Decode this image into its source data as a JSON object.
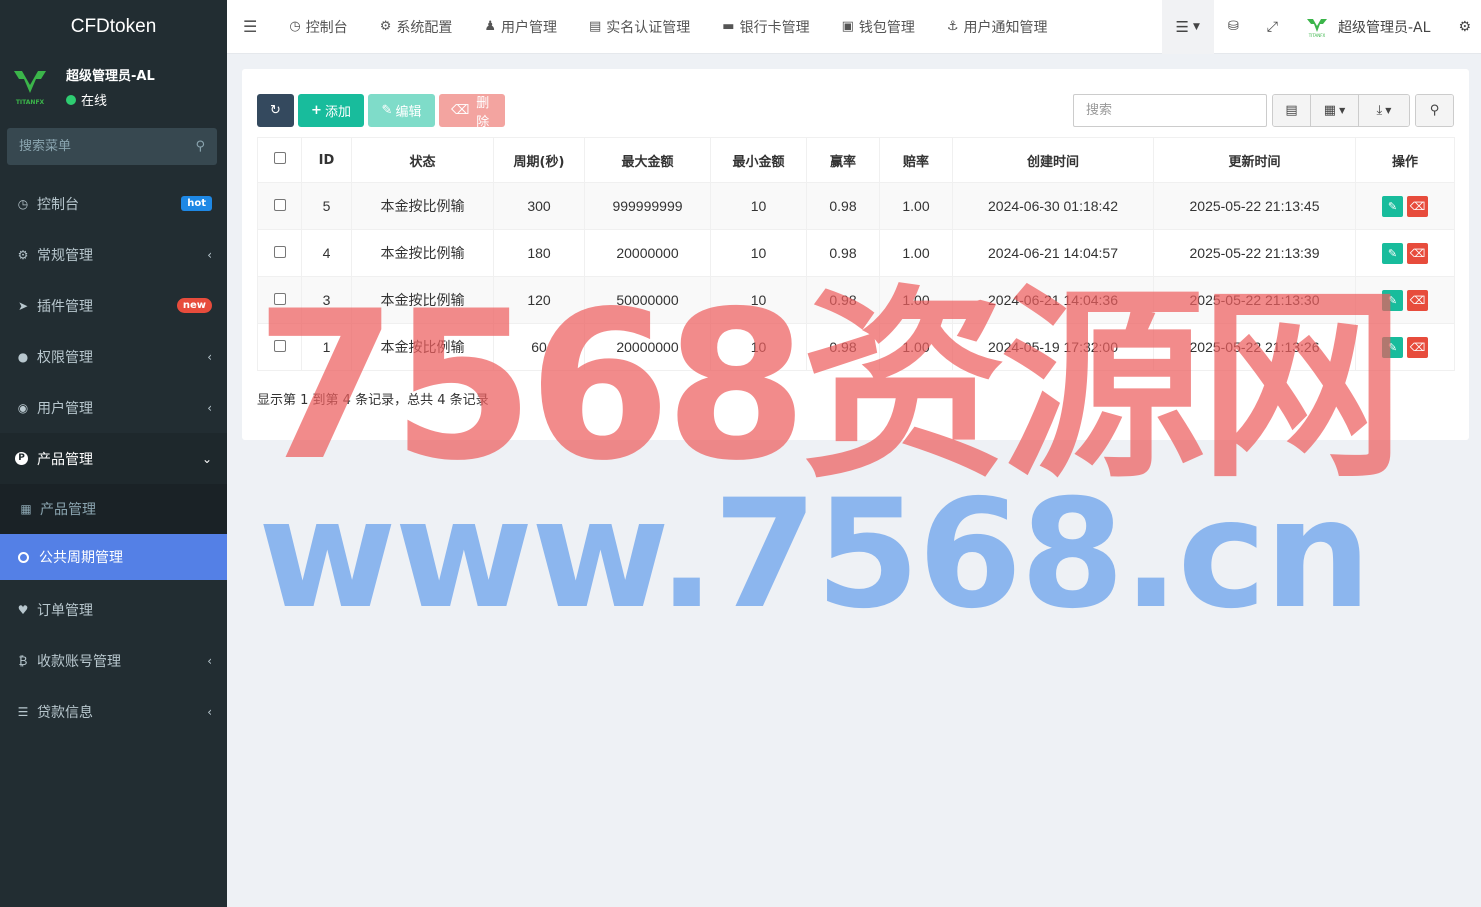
{
  "app": {
    "brand": "CFDtoken"
  },
  "user": {
    "name": "超级管理员-AL",
    "status": "在线"
  },
  "sidebar": {
    "search_placeholder": "搜索菜单",
    "items": [
      {
        "label": "控制台",
        "badge": "hot",
        "icon": "dashboard-icon"
      },
      {
        "label": "常规管理",
        "icon": "cogs-icon"
      },
      {
        "label": "插件管理",
        "badge": "new",
        "icon": "rocket-icon"
      },
      {
        "label": "权限管理",
        "icon": "group-icon"
      },
      {
        "label": "用户管理",
        "icon": "user-circle-icon"
      },
      {
        "label": "产品管理",
        "icon": "product-icon"
      },
      {
        "label": "订单管理",
        "icon": "heartbeat-icon"
      },
      {
        "label": "收款账号管理",
        "icon": "bitcoin-icon"
      },
      {
        "label": "贷款信息",
        "icon": "list-icon"
      }
    ],
    "subitems": [
      {
        "label": "产品管理",
        "icon": "shopping-bag-icon"
      },
      {
        "label": "公共周期管理",
        "icon": "circle-icon"
      }
    ]
  },
  "topnav": {
    "items": [
      {
        "label": "控制台",
        "icon": "dashboard-icon"
      },
      {
        "label": "系统配置",
        "icon": "cog-icon"
      },
      {
        "label": "用户管理",
        "icon": "user-icon"
      },
      {
        "label": "实名认证管理",
        "icon": "id-card-icon"
      },
      {
        "label": "银行卡管理",
        "icon": "credit-card-icon"
      },
      {
        "label": "钱包管理",
        "icon": "money-icon"
      },
      {
        "label": "用户通知管理",
        "icon": "anchor-icon"
      }
    ],
    "admin_name": "超级管理员-AL"
  },
  "toolbar": {
    "add_label": "添加",
    "edit_label": "编辑",
    "delete_label": "删除",
    "search_placeholder": "搜索"
  },
  "table": {
    "columns": [
      "ID",
      "状态",
      "周期(秒)",
      "最大金额",
      "最小金额",
      "赢率",
      "赔率",
      "创建时间",
      "更新时间",
      "操作"
    ],
    "rows": [
      {
        "id": "5",
        "status": "本金按比例输",
        "period": "300",
        "max": "999999999",
        "min": "10",
        "win": "0.98",
        "odds": "1.00",
        "created": "2024-06-30 01:18:42",
        "updated": "2025-05-22 21:13:45"
      },
      {
        "id": "4",
        "status": "本金按比例输",
        "period": "180",
        "max": "20000000",
        "min": "10",
        "win": "0.98",
        "odds": "1.00",
        "created": "2024-06-21 14:04:57",
        "updated": "2025-05-22 21:13:39"
      },
      {
        "id": "3",
        "status": "本金按比例输",
        "period": "120",
        "max": "50000000",
        "min": "10",
        "win": "0.98",
        "odds": "1.00",
        "created": "2024-06-21 14:04:36",
        "updated": "2025-05-22 21:13:30"
      },
      {
        "id": "1",
        "status": "本金按比例输",
        "period": "60",
        "max": "20000000",
        "min": "10",
        "win": "0.98",
        "odds": "1.00",
        "created": "2024-05-19 17:32:00",
        "updated": "2025-05-22 21:13:26"
      }
    ],
    "pagination_text": "显示第 1 到第 4 条记录，总共 4 条记录"
  },
  "watermark": {
    "line1": "7568资源网",
    "line2": "www.7568.cn"
  },
  "colors": {
    "sidebar_bg": "#222d32",
    "active": "#5480e6",
    "success": "#18bc9c",
    "danger": "#e74c3c"
  }
}
